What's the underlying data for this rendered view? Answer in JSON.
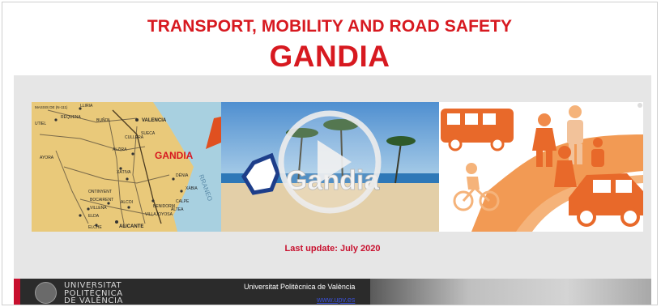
{
  "header": {
    "title": "TRANSPORT, MOBILITY AND ROAD SAFETY",
    "city": "GANDIA"
  },
  "media": {
    "map_label": "GANDIA",
    "map_sea_label": "RRANEO",
    "map_towns": [
      "VALENCIA",
      "LLIRIA",
      "REQUENA",
      "UTIEL",
      "BUÑOL",
      "ALZIRA",
      "XÀTIVA",
      "DÉNIA",
      "BENIDORM",
      "ALCOI",
      "VILLENA",
      "ELDA",
      "ELCHE",
      "ALICANTE",
      "ONTINYENT",
      "BOCAIRENT",
      "XÀBIA",
      "CALPE",
      "ALTEA",
      "VILLAJOYOSA",
      "CULLERA",
      "SUECA",
      "AYORA",
      "MASSIS DE (N-111)"
    ],
    "sign_text": "Gandia",
    "play_icon": "play-icon"
  },
  "update": {
    "text": "Last update: July 2020"
  },
  "footer": {
    "university_line1": "UNIVERSITAT",
    "university_line2": "POLITÈCNICA",
    "university_line3": "DE VALÈNCIA",
    "name": "Universitat Politècnica de València",
    "link": "www.upv.es"
  },
  "colors": {
    "accent": "#d71920",
    "panel": "#e6e6e6",
    "footer": "#2b2b2b",
    "transport_orange": "#f07830"
  }
}
